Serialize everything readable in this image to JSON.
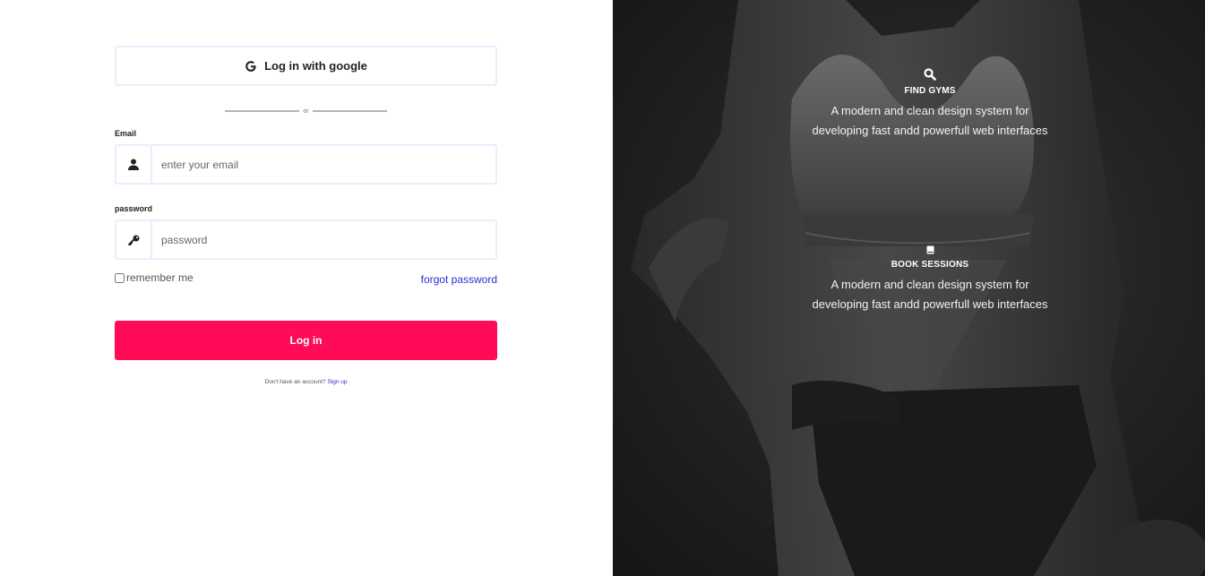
{
  "login": {
    "google_label": "Log in with google",
    "divider_text": "or",
    "email_label": "Email",
    "email_placeholder": "enter your email",
    "password_label": "password",
    "password_placeholder": "password",
    "remember_label": "remember me",
    "forgot_label": "forgot password",
    "login_button": "Log in",
    "no_account_text": "Don't have an account?",
    "signup_link": "Sign up",
    "accent_color": "#ff0b58",
    "link_color": "#2f2fd1"
  },
  "features": [
    {
      "icon": "search-icon",
      "title": "FIND GYMS",
      "line1": "A modern and clean design system for",
      "line2": "developing fast andd powerfull web interfaces"
    },
    {
      "icon": "book-icon",
      "title": "BOOK SESSIONS",
      "line1": "A modern and clean design system for",
      "line2": "developing fast andd powerfull web interfaces"
    }
  ]
}
